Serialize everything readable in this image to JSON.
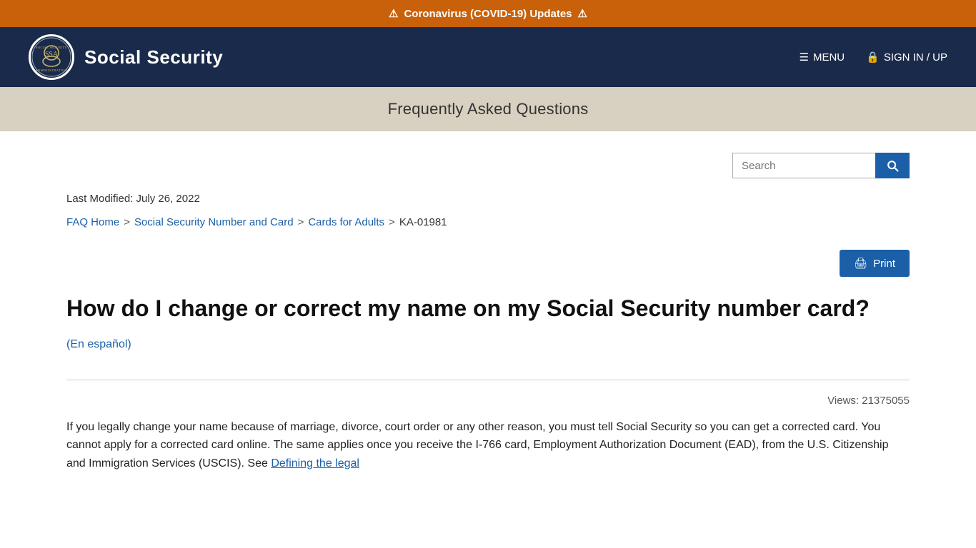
{
  "alert": {
    "icon_left": "⚠",
    "text": "Coronavirus (COVID-19) Updates",
    "icon_right": "⚠"
  },
  "header": {
    "site_title": "Social Security",
    "menu_label": "MENU",
    "signin_label": "SIGN IN / UP"
  },
  "subtitle_bar": {
    "title": "Frequently Asked Questions"
  },
  "search": {
    "placeholder": "Search",
    "button_label": "Search"
  },
  "last_modified": {
    "label": "Last Modified: July 26, 2022"
  },
  "breadcrumb": {
    "items": [
      {
        "text": "FAQ Home",
        "link": true
      },
      {
        "text": "Social Security Number and Card",
        "link": true
      },
      {
        "text": "Cards for Adults",
        "link": true
      },
      {
        "text": "KA-01981",
        "link": false
      }
    ],
    "separator": ">"
  },
  "print_button": {
    "label": "Print"
  },
  "article": {
    "title": "How do I change or correct my name on my Social Security number card?",
    "spanish_link": "(En español)",
    "views_label": "Views:",
    "views_count": "21375055",
    "body_text": "If you legally change your name because of marriage, divorce, court order or any other reason, you must tell Social Security so you can get a corrected card. You cannot apply for a corrected card online. The same applies once you receive the I-766 card, Employment Authorization Document (EAD), from the U.S. Citizenship and Immigration Services (USCIS). See ",
    "body_link_text": "Defining the legal"
  }
}
